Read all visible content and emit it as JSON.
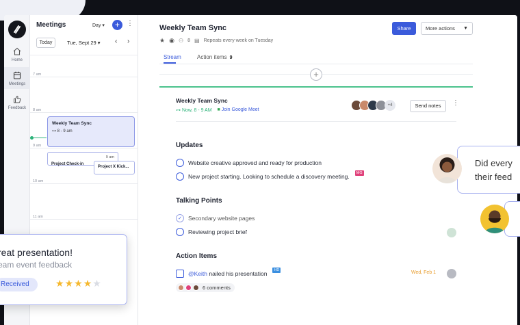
{
  "nav": {
    "items": [
      {
        "label": "Home",
        "icon": "home-icon"
      },
      {
        "label": "Meetings",
        "icon": "calendar-icon"
      },
      {
        "label": "Feedback",
        "icon": "thumbs-up-icon"
      }
    ]
  },
  "meetings": {
    "title": "Meetings",
    "view": "Day ▾",
    "today": "Today",
    "date": "Tue, Sept 29 ▾",
    "hours": [
      "7 am",
      "8 am",
      "9 am",
      "10 am",
      "11 am"
    ],
    "events": {
      "main_title": "Weekly Team Sync",
      "main_time": "8 - 9 am",
      "a_title": "Project Check-in",
      "a_time": "9 am",
      "b_title": "Project X Kick..."
    }
  },
  "meeting": {
    "title": "Weekly Team Sync",
    "attendees": "8",
    "repeat": "Repeats every week on Tuesday",
    "share": "Share",
    "more": "More actions",
    "tabs": {
      "stream": "Stream",
      "action_items": "Action items",
      "action_count": "9"
    }
  },
  "card": {
    "title": "Weekly Team Sync",
    "now": "Now, 8 - 9 AM",
    "meet": "Join Google Meet",
    "more_count": "+4",
    "send": "Send notes",
    "updates_heading": "Updates",
    "updates": [
      "Website creative approved and ready for production",
      "New project starting. Looking to schedule a discovery meeting."
    ],
    "tag_mg": "MG",
    "talking_heading": "Talking Points",
    "talking": [
      "Secondary website pages",
      "Reviewing project brief"
    ],
    "action_heading": "Action Items",
    "action_mention": "@Keith",
    "action_text": " nailed his presentation",
    "tag_hd": "HD",
    "due": "Wed, Feb 1",
    "comments": "6 comments"
  },
  "feedback": {
    "title": "reat presentation!",
    "subtitle": "eam event feedback",
    "badge": "Received",
    "rating": 4,
    "max_rating": 5
  },
  "chat": {
    "line1": "Did every",
    "line2": "their feed"
  },
  "colors": {
    "accent": "#3b5bdb",
    "success": "#2db37a",
    "warning": "#e89b2a",
    "star": "#f5b82e"
  }
}
